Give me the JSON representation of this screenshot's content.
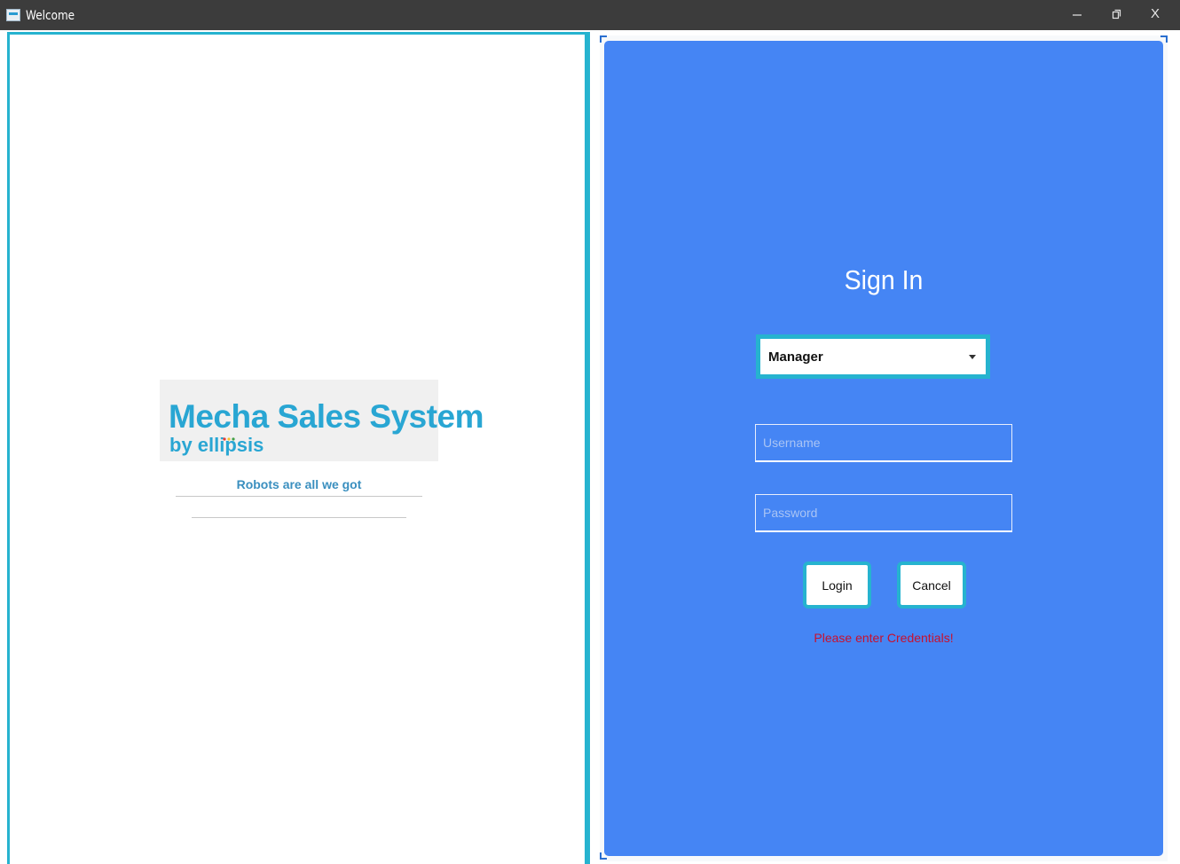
{
  "window": {
    "title": "Welcome",
    "controls": {
      "minimize_icon": "minimize-icon",
      "restore_icon": "restore-icon",
      "close_label": "X"
    }
  },
  "branding": {
    "logo_title": "Mecha Sales System",
    "logo_subtitle": "by ellipsis",
    "tagline": "Robots are all we got",
    "brand_color": "#29a6d3"
  },
  "login": {
    "heading": "Sign In",
    "role": {
      "selected": "Manager"
    },
    "username_placeholder": "Username",
    "password_placeholder": "Password",
    "login_label": "Login",
    "cancel_label": "Cancel",
    "status_message": "Please enter Credentials!"
  },
  "colors": {
    "panel_blue": "#4585f4",
    "accent_teal": "#26b3cf",
    "error_red": "#c8102e",
    "titlebar": "#3c3c3c"
  }
}
